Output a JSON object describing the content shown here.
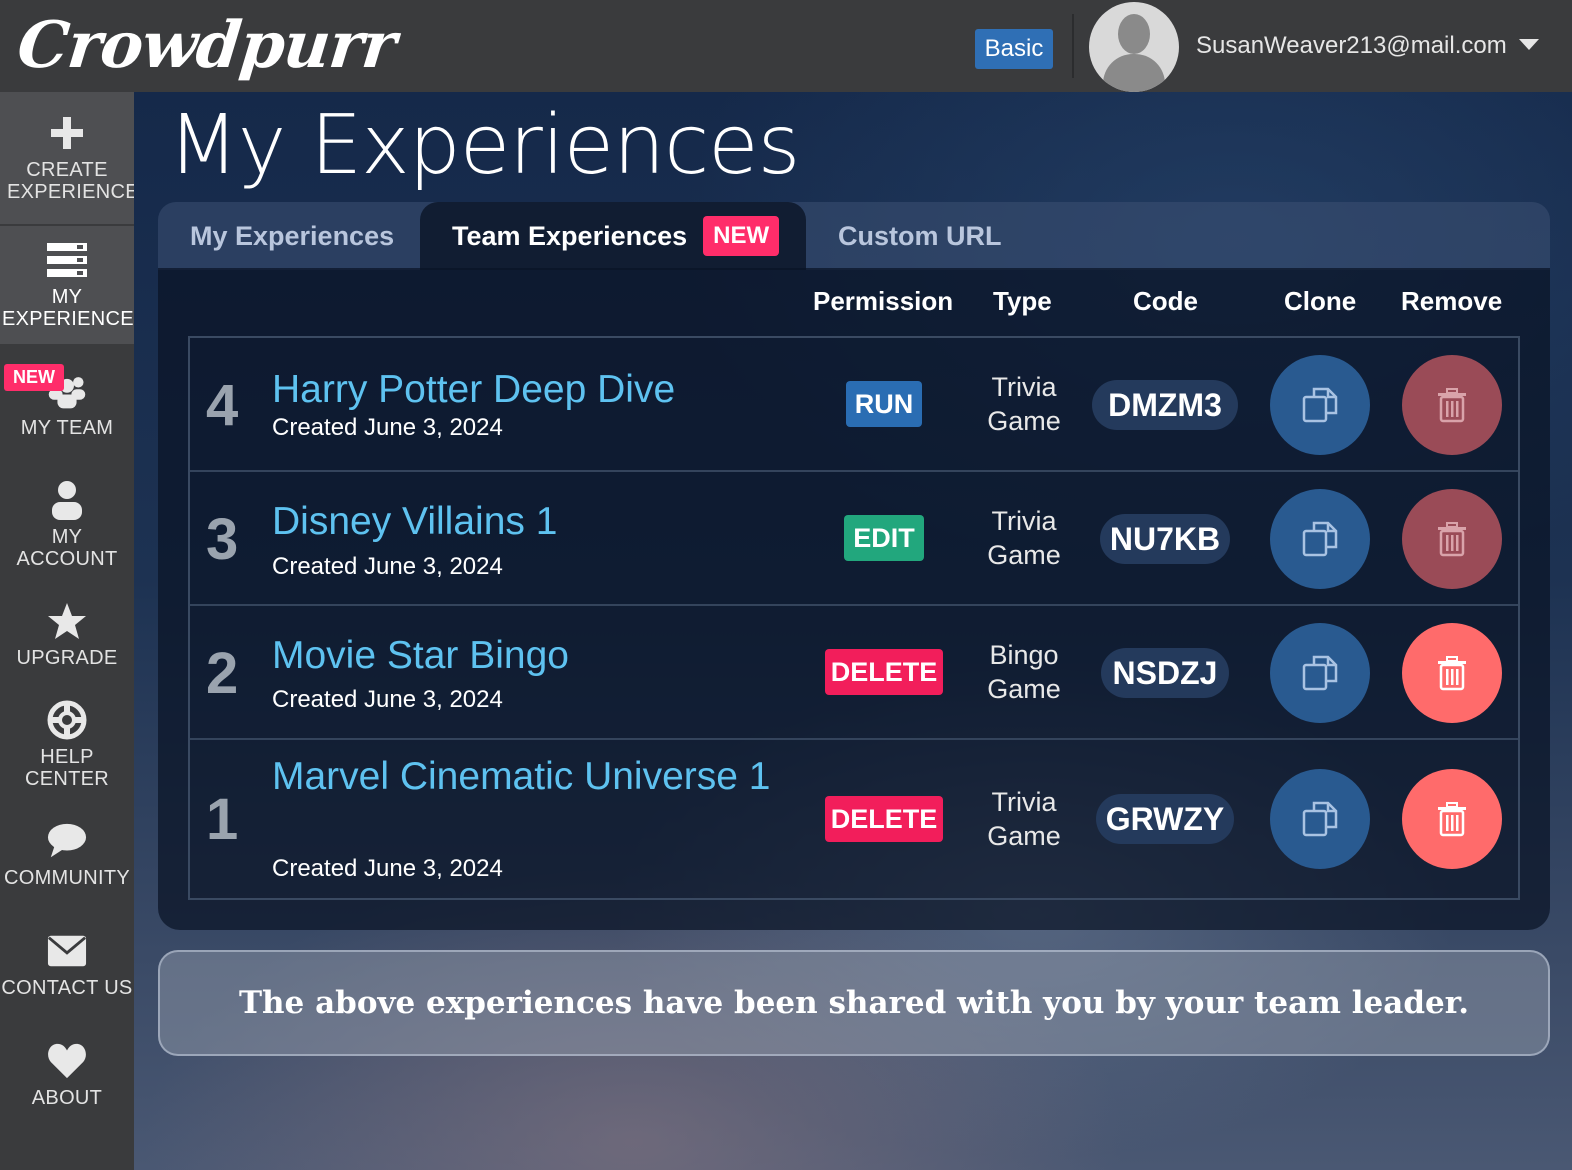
{
  "header": {
    "logo": "Crowdpurr",
    "plan": "Basic",
    "user_email": "SusanWeaver213@mail.com"
  },
  "sidebar": {
    "new_badge": "NEW",
    "items": [
      {
        "label": "CREATE EXPERIENCE",
        "icon": "plus-icon"
      },
      {
        "label": "MY EXPERIENCES",
        "icon": "list-icon"
      },
      {
        "label": "MY TEAM",
        "icon": "team-icon"
      },
      {
        "label": "MY ACCOUNT",
        "icon": "user-icon"
      },
      {
        "label": "UPGRADE",
        "icon": "star-icon"
      },
      {
        "label": "HELP CENTER",
        "icon": "lifebuoy-icon"
      },
      {
        "label": "COMMUNITY",
        "icon": "chat-bubble-icon"
      },
      {
        "label": "CONTACT US",
        "icon": "envelope-icon"
      },
      {
        "label": "ABOUT",
        "icon": "heart-icon"
      }
    ]
  },
  "page": {
    "title": "My Experiences",
    "tabs": [
      {
        "label": "My Experiences"
      },
      {
        "label": "Team Experiences",
        "badge": "NEW",
        "active": true
      },
      {
        "label": "Custom URL"
      }
    ],
    "columns": {
      "permission": "Permission",
      "type": "Type",
      "code": "Code",
      "clone": "Clone",
      "remove": "Remove"
    },
    "rows": [
      {
        "num": "4",
        "title": "Harry Potter Deep Dive",
        "date": "Created June 3, 2024",
        "permission": "RUN",
        "type_line1": "Trivia",
        "type_line2": "Game",
        "code": "DMZM3",
        "removable": false
      },
      {
        "num": "3",
        "title": "Disney Villains 1",
        "date": "Created June 3, 2024",
        "permission": "EDIT",
        "type_line1": "Trivia",
        "type_line2": "Game",
        "code": "NU7KB",
        "removable": false
      },
      {
        "num": "2",
        "title": "Movie Star Bingo",
        "date": "Created June 3, 2024",
        "permission": "DELETE",
        "type_line1": "Bingo",
        "type_line2": "Game",
        "code": "NSDZJ",
        "removable": true
      },
      {
        "num": "1",
        "title": "Marvel Cinematic Universe 1",
        "date": "Created June 3, 2024",
        "permission": "DELETE",
        "type_line1": "Trivia",
        "type_line2": "Game",
        "code": "GRWZY",
        "removable": true
      }
    ],
    "note": "The above experiences have been shared with you by your team leader."
  },
  "colors": {
    "accent_blue": "#2f6fb5",
    "new_pink": "#ff2d6a",
    "title_cyan": "#5ec2f0",
    "edit_green": "#22a77d",
    "remove_red": "#ff6b6b"
  }
}
